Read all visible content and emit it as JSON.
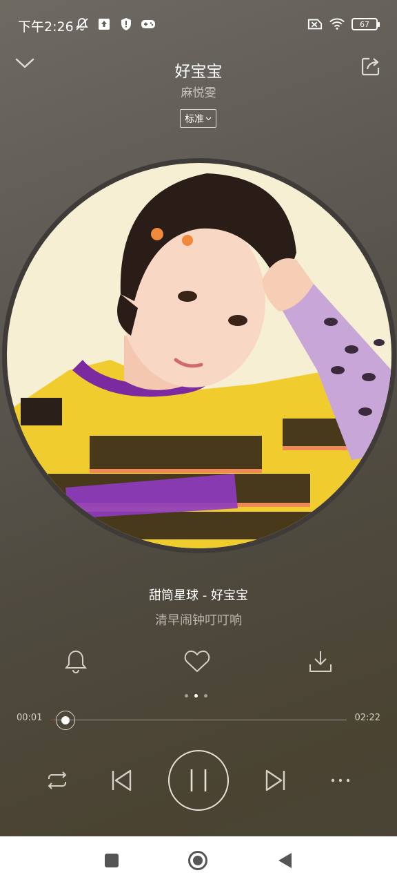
{
  "status_bar": {
    "time": "下午2:26",
    "battery_level": "67",
    "left_icons": [
      "mute-bell-icon",
      "upload-icon",
      "shield-icon",
      "gamepad-icon"
    ],
    "right_icons": [
      "sim-off-icon",
      "wifi-icon",
      "battery-icon"
    ]
  },
  "header": {
    "title": "好宝宝",
    "artist": "麻悦雯",
    "quality_label": "标准"
  },
  "album": {
    "description_icon": "album-cover-image"
  },
  "lyrics": {
    "track_line": "甜筒星球 - 好宝宝",
    "current_line": "清早闹钟叮叮响"
  },
  "actions": [
    "ringtone-bell-icon",
    "favorite-heart-icon",
    "download-icon"
  ],
  "pager": {
    "count": 3,
    "active_index": 1
  },
  "progress": {
    "current": "00:01",
    "total": "02:22",
    "fraction": 0.007
  },
  "controls": [
    "repeat-icon",
    "previous-icon",
    "pause-icon",
    "next-icon",
    "more-icon"
  ],
  "colors": {
    "accent": "#e03030",
    "nav_bg": "#ffffff",
    "nav_icon": "#555555"
  }
}
